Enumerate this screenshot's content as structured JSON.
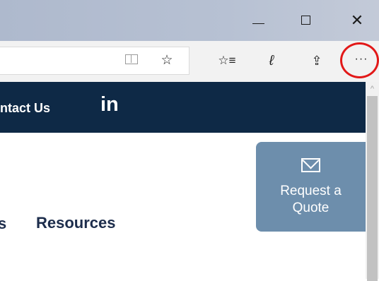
{
  "window": {
    "minimize": "—",
    "close": "✕"
  },
  "toolbar": {
    "star": "☆",
    "favorites": "☆≡",
    "notes": "ℓ",
    "share": "⇪",
    "more": "···"
  },
  "nav": {
    "contact_us": "ntact Us",
    "linkedin": "in"
  },
  "content": {
    "resources_sep": "s",
    "resources": "Resources"
  },
  "quote": {
    "line1": "Request a",
    "line2": "Quote"
  },
  "scrollbar": {
    "up_arrow": "^"
  },
  "colors": {
    "nav_background": "#0e2946",
    "quote_background": "#6d8eac",
    "highlight_circle": "#e21818"
  }
}
